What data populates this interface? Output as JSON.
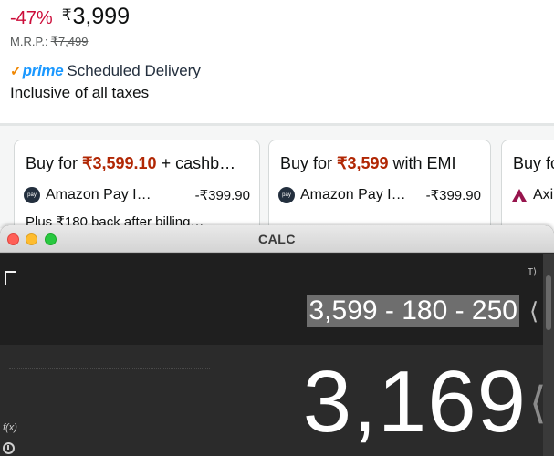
{
  "product": {
    "discount": "-47%",
    "currency_symbol": "₹",
    "price": "3,999",
    "mrp_label": "M.R.P.:",
    "mrp_value": "₹7,499",
    "prime_check": "✓",
    "prime_label": "prime",
    "delivery_label": "Scheduled Delivery",
    "taxes_label": "Inclusive of all taxes"
  },
  "offers": [
    {
      "title_prefix": "Buy for ",
      "title_amount": "₹3,599.10",
      "title_suffix": " + cashb…",
      "payment_name": "Amazon Pay I…",
      "payment_amount": "-₹399.90",
      "payment_icon": "amazon-pay-icon",
      "payment_badge": "pay",
      "note": "Plus ₹180 back after billing…"
    },
    {
      "title_prefix": "Buy for ",
      "title_amount": "₹3,599",
      "title_suffix": " with EMI",
      "payment_name": "Amazon Pay I…",
      "payment_amount": "-₹399.90",
      "payment_icon": "amazon-pay-icon",
      "payment_badge": "pay",
      "note": ""
    },
    {
      "title_prefix": "Buy fo",
      "title_amount": "",
      "title_suffix": "",
      "payment_name": "Axi",
      "payment_amount": "",
      "payment_icon": "axis-bank-icon",
      "note": ""
    }
  ],
  "calculator": {
    "window_title": "CALC",
    "t_mark": "T⟩",
    "expression": "3,599 - 180 - 250",
    "result": "3,169",
    "angle_glyph": "⟨",
    "fx_label": "f(x)"
  },
  "colors": {
    "discount": "#cc0c39",
    "offer_amount": "#b12704",
    "prime": "#1a98ff",
    "prime_check": "#f08804",
    "calc_background": "#2a2a2a",
    "expression_highlight": "#6e6e6e"
  }
}
